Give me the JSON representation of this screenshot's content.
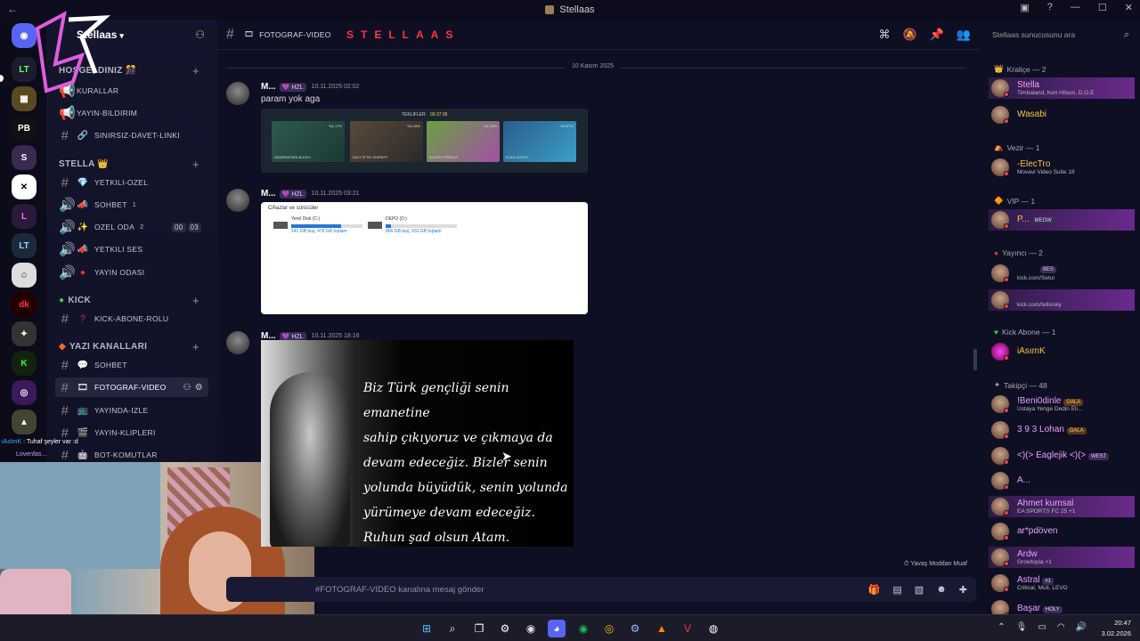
{
  "titlebar": {
    "back": "←",
    "title": "Stellaas"
  },
  "server": {
    "name": "Stellaas"
  },
  "overlay_chat": [
    {
      "user": "iAsImK",
      "text": "Tuhaf şeyler var :d"
    },
    {
      "user": "Lovenfas...",
      "text": ""
    }
  ],
  "categories": [
    {
      "label": "HOŞGELDINIZ 🎊"
    },
    {
      "label": "STELLA 👑"
    },
    {
      "label": "KICK"
    },
    {
      "label": "YAZI KANALLARI"
    }
  ],
  "channels": [
    {
      "label": "KURALLAR"
    },
    {
      "label": "YAYIN-BILDIRIM"
    },
    {
      "label": "SINIRSIZ-DAVET-LINKI"
    },
    {
      "label": "YETKILI-OZEL"
    },
    {
      "label": "SOHBET",
      "sup": "1"
    },
    {
      "label": "OZEL ODA",
      "sup": "2",
      "b1": "00",
      "b2": "03"
    },
    {
      "label": "YETKILI SES"
    },
    {
      "label": "YAYIN ODASI"
    },
    {
      "label": "KICK-ABONE-ROLU"
    },
    {
      "label": "SOHBET"
    },
    {
      "label": "FOTOGRAF-VIDEO"
    },
    {
      "label": "YAYINDA-IZLE"
    },
    {
      "label": "YAYIN-KLIPLERI"
    },
    {
      "label": "BOT-KOMUTLAR"
    }
  ],
  "chat": {
    "channel": "FOTOGRAF-VIDEO",
    "topic": "STELLAAS",
    "date_divider": "10 Kasım 2025",
    "composer_placeholder": "#FOTOGRAF-VIDEO kanalına mesaj gönder",
    "status_note": "Yavaş Moddan Muaf"
  },
  "messages": [
    {
      "author": "M...",
      "tag": "HZL",
      "time": "10.11.2025 02:02",
      "text": "param yok aga"
    },
    {
      "author": "M...",
      "tag": "HZL",
      "time": "10.11.2025 03:21",
      "text": ""
    },
    {
      "author": "M...",
      "tag": "HZL",
      "time": "10.11.2025 18:16",
      "text": ""
    }
  ],
  "image1": {
    "header": "TEKLIFLER",
    "timer": "00:37:36",
    "items": [
      "DEMIRKESEN BUCKY",
      "KAYI TETIK SHERIFF",
      "BLASTX FRENZY",
      "ELAS GHOST"
    ],
    "pcts": [
      "%1.17%",
      "%2.26%",
      "%1.25%",
      "%0.87%"
    ]
  },
  "image2": {
    "caption": "Cihazlar ve sürücüler",
    "drives": [
      {
        "name": "Yerel Disk (C:)",
        "info": "141 GB boş, 476 GB toplam",
        "fill": 0.7
      },
      {
        "name": "DEPO (D:)",
        "info": "866 GB boş, 931 GB toplam",
        "fill": 0.07
      }
    ]
  },
  "image3": {
    "quote": "Biz Türk gençliği senin emanetine\nsahip çıkıyoruz ve çıkmaya da\ndevam edeceğiz. Bizler senin\nyolunda büyüdük, senin yolunda\nyürümeye devam edeceğiz.\nRuhun şad olsun Atam."
  },
  "members": {
    "search_placeholder": "Stellaas sunucusunu ara",
    "groups": [
      {
        "label": "Kraliçe — 2"
      },
      {
        "label": "Vezir — 1"
      },
      {
        "label": "VIP — 1"
      },
      {
        "label": "Yayıncı — 2"
      },
      {
        "label": "Kick Abone — 1"
      },
      {
        "label": "Takipçi — 48"
      }
    ],
    "list": [
      {
        "name": "Stella",
        "sub": "Timbaland, Keri Hilson, D.O.E",
        "color": "#f7a3ff"
      },
      {
        "name": "Wasabi",
        "sub": "",
        "color": "#f5c542"
      },
      {
        "name": "-ElecTro",
        "sub": "Movavi Video Suite 18",
        "color": "#f5c542"
      },
      {
        "name": "P...",
        "sub": "",
        "tag": "MEOW",
        "color": "#f5c542"
      },
      {
        "name": "",
        "sub": "kick.com/Setul",
        "tag": "BES",
        "color": "#fff"
      },
      {
        "name": "",
        "sub": "kick.com/tellivsky",
        "color": "#fff"
      },
      {
        "name": "iAsımK",
        "sub": "",
        "color": "#f5c542"
      },
      {
        "name": "!Beni0dinle",
        "sub": "Ustaya Yenge Dedin Eli...",
        "tag": "GALA",
        "color": "#e6a0ff"
      },
      {
        "name": "3 9 3 Lohan",
        "sub": "",
        "tag": "GALA",
        "color": "#e6a0ff"
      },
      {
        "name": "<)(> Eaglejik <)(>",
        "sub": "",
        "tag": "WEST",
        "color": "#e6a0ff"
      },
      {
        "name": "A...",
        "sub": "",
        "color": "#e6a0ff"
      },
      {
        "name": "Ahmet kumsal",
        "sub": "EA SPORTS FC 25 +1",
        "color": "#e6a0ff"
      },
      {
        "name": "ar*pdöven",
        "sub": "",
        "color": "#e6a0ff"
      },
      {
        "name": "Ardw",
        "sub": "Growtopia +1",
        "color": "#e6a0ff"
      },
      {
        "name": "Astral",
        "sub": "Critical, Muti, LEVO",
        "tag": "#1",
        "color": "#e6a0ff"
      },
      {
        "name": "Başar",
        "sub": "",
        "tag": "HOLY",
        "color": "#e6a0ff"
      }
    ]
  },
  "taskbar": {
    "time": "20:47",
    "date": "3.02.2026"
  },
  "colors": {
    "accent": "#ff3344",
    "background": "#0f0f24",
    "sidebar": "#14142c"
  }
}
